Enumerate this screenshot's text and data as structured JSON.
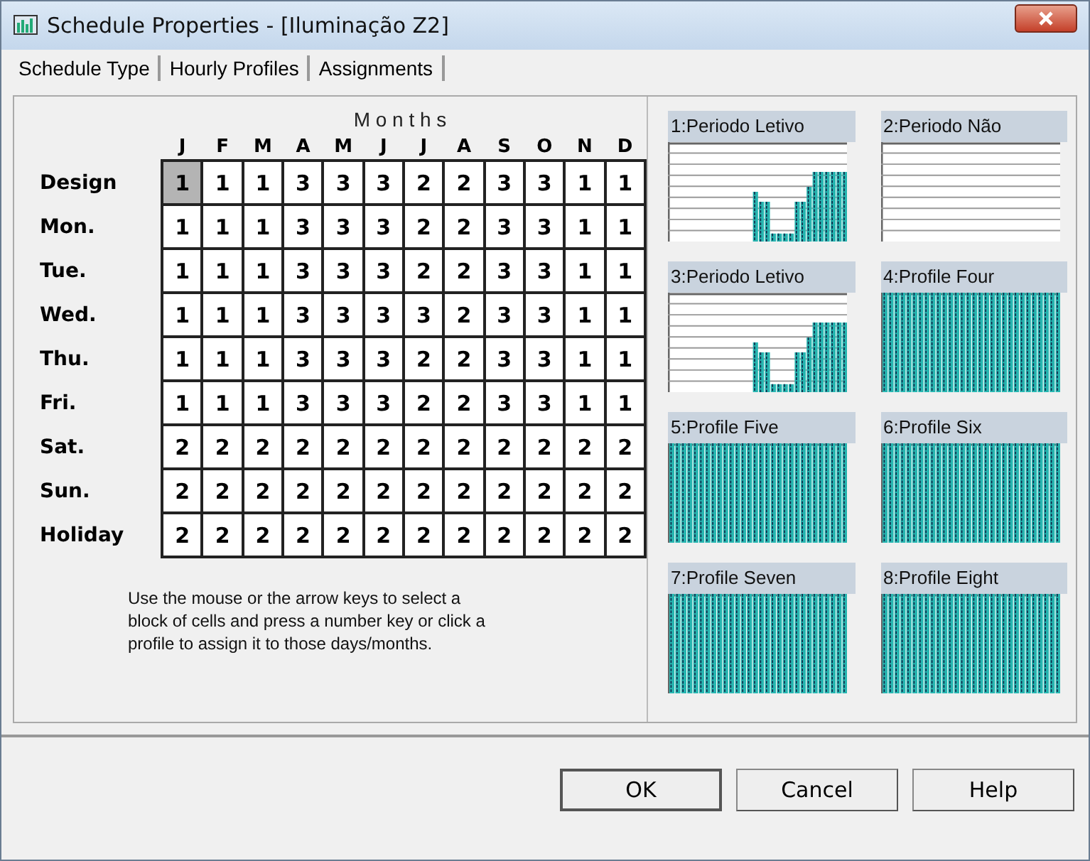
{
  "window": {
    "title": "Schedule Properties - [Iluminação Z2]"
  },
  "tabs": [
    "Schedule Type",
    "Hourly Profiles",
    "Assignments"
  ],
  "grid": {
    "title": "M o n t h s",
    "months": [
      "J",
      "F",
      "M",
      "A",
      "M",
      "J",
      "J",
      "A",
      "S",
      "O",
      "N",
      "D"
    ],
    "rows": [
      {
        "label": "Design",
        "cells": [
          {
            "value": "1",
            "selected": true
          },
          {
            "value": "1",
            "selected": false
          },
          {
            "value": "1",
            "selected": false
          },
          {
            "value": "3",
            "selected": false
          },
          {
            "value": "3",
            "selected": false
          },
          {
            "value": "3",
            "selected": false
          },
          {
            "value": "2",
            "selected": false
          },
          {
            "value": "2",
            "selected": false
          },
          {
            "value": "3",
            "selected": false
          },
          {
            "value": "3",
            "selected": false
          },
          {
            "value": "1",
            "selected": false
          },
          {
            "value": "1",
            "selected": false
          }
        ]
      },
      {
        "label": "Mon.",
        "cells": [
          {
            "value": "1",
            "selected": false
          },
          {
            "value": "1",
            "selected": false
          },
          {
            "value": "1",
            "selected": false
          },
          {
            "value": "3",
            "selected": false
          },
          {
            "value": "3",
            "selected": false
          },
          {
            "value": "3",
            "selected": false
          },
          {
            "value": "2",
            "selected": false
          },
          {
            "value": "2",
            "selected": false
          },
          {
            "value": "3",
            "selected": false
          },
          {
            "value": "3",
            "selected": false
          },
          {
            "value": "1",
            "selected": false
          },
          {
            "value": "1",
            "selected": false
          }
        ]
      },
      {
        "label": "Tue.",
        "cells": [
          {
            "value": "1",
            "selected": false
          },
          {
            "value": "1",
            "selected": false
          },
          {
            "value": "1",
            "selected": false
          },
          {
            "value": "3",
            "selected": false
          },
          {
            "value": "3",
            "selected": false
          },
          {
            "value": "3",
            "selected": false
          },
          {
            "value": "2",
            "selected": false
          },
          {
            "value": "2",
            "selected": false
          },
          {
            "value": "3",
            "selected": false
          },
          {
            "value": "3",
            "selected": false
          },
          {
            "value": "1",
            "selected": false
          },
          {
            "value": "1",
            "selected": false
          }
        ]
      },
      {
        "label": "Wed.",
        "cells": [
          {
            "value": "1",
            "selected": false
          },
          {
            "value": "1",
            "selected": false
          },
          {
            "value": "1",
            "selected": false
          },
          {
            "value": "3",
            "selected": false
          },
          {
            "value": "3",
            "selected": false
          },
          {
            "value": "3",
            "selected": false
          },
          {
            "value": "3",
            "selected": false
          },
          {
            "value": "2",
            "selected": false
          },
          {
            "value": "3",
            "selected": false
          },
          {
            "value": "3",
            "selected": false
          },
          {
            "value": "1",
            "selected": false
          },
          {
            "value": "1",
            "selected": false
          }
        ]
      },
      {
        "label": "Thu.",
        "cells": [
          {
            "value": "1",
            "selected": false
          },
          {
            "value": "1",
            "selected": false
          },
          {
            "value": "1",
            "selected": false
          },
          {
            "value": "3",
            "selected": false
          },
          {
            "value": "3",
            "selected": false
          },
          {
            "value": "3",
            "selected": false
          },
          {
            "value": "2",
            "selected": false
          },
          {
            "value": "2",
            "selected": false
          },
          {
            "value": "3",
            "selected": false
          },
          {
            "value": "3",
            "selected": false
          },
          {
            "value": "1",
            "selected": false
          },
          {
            "value": "1",
            "selected": false
          }
        ]
      },
      {
        "label": "Fri.",
        "cells": [
          {
            "value": "1",
            "selected": false
          },
          {
            "value": "1",
            "selected": false
          },
          {
            "value": "1",
            "selected": false
          },
          {
            "value": "3",
            "selected": false
          },
          {
            "value": "3",
            "selected": false
          },
          {
            "value": "3",
            "selected": false
          },
          {
            "value": "2",
            "selected": false
          },
          {
            "value": "2",
            "selected": false
          },
          {
            "value": "3",
            "selected": false
          },
          {
            "value": "3",
            "selected": false
          },
          {
            "value": "1",
            "selected": false
          },
          {
            "value": "1",
            "selected": false
          }
        ]
      },
      {
        "label": "Sat.",
        "cells": [
          {
            "value": "2",
            "selected": false
          },
          {
            "value": "2",
            "selected": false
          },
          {
            "value": "2",
            "selected": false
          },
          {
            "value": "2",
            "selected": false
          },
          {
            "value": "2",
            "selected": false
          },
          {
            "value": "2",
            "selected": false
          },
          {
            "value": "2",
            "selected": false
          },
          {
            "value": "2",
            "selected": false
          },
          {
            "value": "2",
            "selected": false
          },
          {
            "value": "2",
            "selected": false
          },
          {
            "value": "2",
            "selected": false
          },
          {
            "value": "2",
            "selected": false
          }
        ]
      },
      {
        "label": "Sun.",
        "cells": [
          {
            "value": "2",
            "selected": false
          },
          {
            "value": "2",
            "selected": false
          },
          {
            "value": "2",
            "selected": false
          },
          {
            "value": "2",
            "selected": false
          },
          {
            "value": "2",
            "selected": false
          },
          {
            "value": "2",
            "selected": false
          },
          {
            "value": "2",
            "selected": false
          },
          {
            "value": "2",
            "selected": false
          },
          {
            "value": "2",
            "selected": false
          },
          {
            "value": "2",
            "selected": false
          },
          {
            "value": "2",
            "selected": false
          },
          {
            "value": "2",
            "selected": false
          }
        ]
      },
      {
        "label": "Holiday",
        "cells": [
          {
            "value": "2",
            "selected": false
          },
          {
            "value": "2",
            "selected": false
          },
          {
            "value": "2",
            "selected": false
          },
          {
            "value": "2",
            "selected": false
          },
          {
            "value": "2",
            "selected": false
          },
          {
            "value": "2",
            "selected": false
          },
          {
            "value": "2",
            "selected": false
          },
          {
            "value": "2",
            "selected": false
          },
          {
            "value": "2",
            "selected": false
          },
          {
            "value": "2",
            "selected": false
          },
          {
            "value": "2",
            "selected": false
          },
          {
            "value": "2",
            "selected": false
          }
        ]
      }
    ]
  },
  "instructions": "Use the mouse or the arrow keys to select a block of cells and press a number key or click a profile to assign it to those days/months.",
  "profiles": [
    {
      "label": "1:Periodo Letivo",
      "kind": "partial"
    },
    {
      "label": "2:Periodo Não",
      "kind": "empty"
    },
    {
      "label": "3:Periodo Letivo",
      "kind": "partial"
    },
    {
      "label": "4:Profile Four",
      "kind": "full"
    },
    {
      "label": "5:Profile Five",
      "kind": "full"
    },
    {
      "label": "6:Profile Six",
      "kind": "full"
    },
    {
      "label": "7:Profile Seven",
      "kind": "full"
    },
    {
      "label": "8:Profile Eight",
      "kind": "full"
    }
  ],
  "buttons": [
    {
      "label": "OK",
      "kind": "default"
    },
    {
      "label": "Cancel",
      "kind": "normal"
    },
    {
      "label": "Help",
      "kind": "normal"
    }
  ]
}
